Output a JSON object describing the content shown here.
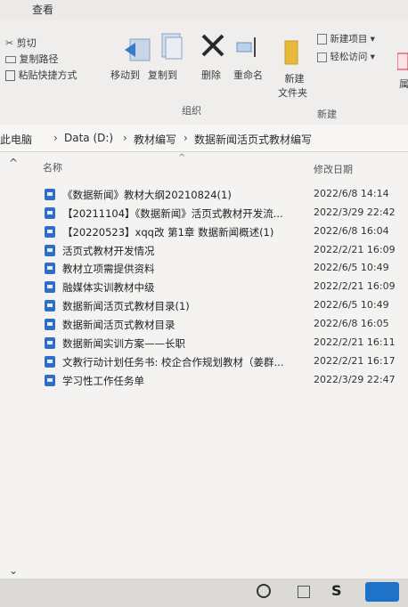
{
  "menu": {
    "view_tab": "查看"
  },
  "ribbon": {
    "cut": "剪切",
    "copy_path": "复制路径",
    "paste_shortcut": "粘贴快捷方式",
    "move_to": "移动到",
    "copy_to": "复制到",
    "delete": "删除",
    "rename": "重命名",
    "new_folder_line1": "新建",
    "new_folder_line2": "文件夹",
    "new_item": "新建项目 ▾",
    "easy_access": "轻松访问 ▾",
    "attr_partial": "属",
    "group_organize": "组织",
    "group_new": "新建"
  },
  "breadcrumb": {
    "root": "此电脑",
    "c1": "Data (D:)",
    "c2": "教材编写",
    "c3": "数据新闻活页式教材编写",
    "sep": "›"
  },
  "columns": {
    "name": "名称",
    "modified": "修改日期"
  },
  "files": [
    {
      "name": "《数据新闻》教材大纲20210824(1)",
      "date": "2022/6/8 14:14"
    },
    {
      "name": "【20211104】《数据新闻》活页式教材开发流...",
      "date": "2022/3/29 22:42"
    },
    {
      "name": "【20220523】xqq改 第1章 数据新闻概述(1)",
      "date": "2022/6/8 16:04"
    },
    {
      "name": "活页式教材开发情况",
      "date": "2022/2/21 16:09"
    },
    {
      "name": "教材立项需提供资料",
      "date": "2022/6/5 10:49"
    },
    {
      "name": "融媒体实训教材中级",
      "date": "2022/2/21 16:09"
    },
    {
      "name": "数据新闻活页式教材目录(1)",
      "date": "2022/6/5 10:49"
    },
    {
      "name": "数据新闻活页式教材目录",
      "date": "2022/6/8 16:05"
    },
    {
      "name": "数据新闻实训方案——长职",
      "date": "2022/2/21 16:11"
    },
    {
      "name": "文教行动计划任务书: 校企合作规划教材（姜群...",
      "date": "2022/2/21 16:17"
    },
    {
      "name": "学习性工作任务单",
      "date": "2022/3/29 22:47"
    }
  ],
  "colors": {
    "accent": "#2f6ec7",
    "delete_x": "#2a2a2a",
    "folder": "#e8b93a"
  }
}
